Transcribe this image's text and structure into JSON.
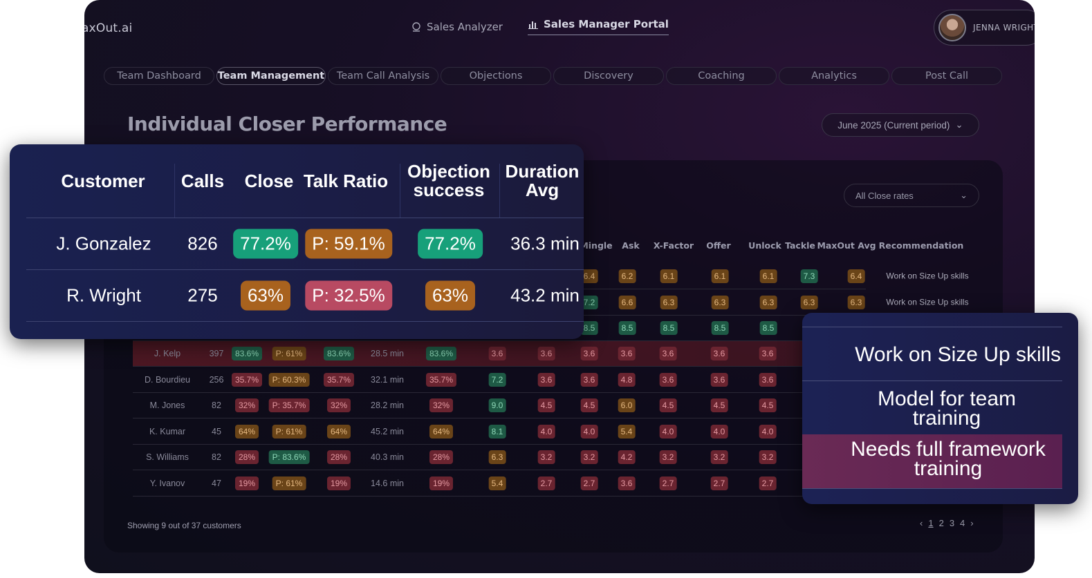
{
  "header": {
    "logo": "axOut.ai",
    "nav": [
      {
        "label": "Sales Analyzer",
        "icon": "analyzer-icon"
      },
      {
        "label": "Sales Manager Portal",
        "icon": "bar-chart-icon"
      }
    ],
    "user": {
      "name": "JENNA WRIGHT"
    }
  },
  "tabs": [
    "Team Dashboard",
    "Team Management",
    "Team Call Analysis",
    "Objections",
    "Discovery",
    "Coaching",
    "Analytics",
    "Post Call"
  ],
  "page": {
    "title": "Individual Closer Performance",
    "period": "June 2025 (Current period)",
    "rate_filter": "All Close rates"
  },
  "table": {
    "columns_visible": [
      "Mingle",
      "Ask",
      "X-Factor",
      "Offer",
      "Unlock",
      "Tackle",
      "MaxOut Avg",
      "Recommendation"
    ],
    "partial_rows": [
      {
        "scores": [
          "6.4",
          "6.2",
          "6.1",
          "6.1",
          "6.1",
          "7.3",
          "6.4"
        ],
        "colors": [
          "o",
          "o",
          "o",
          "o",
          "o",
          "g",
          "o"
        ],
        "rec": "Work on Size Up skills"
      },
      {
        "scores": [
          "7.2",
          "6.6",
          "6.3",
          "6.3",
          "6.3",
          "6.3",
          "6.3"
        ],
        "colors": [
          "g",
          "o",
          "o",
          "o",
          "o",
          "o",
          "o"
        ],
        "rec": "Work on Size Up skills"
      },
      {
        "scores": [
          "8.5",
          "8.5",
          "8.5",
          "8.5",
          "8.5",
          "",
          ""
        ],
        "colors": [
          "g",
          "g",
          "g",
          "g",
          "g",
          "",
          ""
        ],
        "rec": ""
      }
    ],
    "rows": [
      {
        "name": "J. Kelp",
        "calls": "397",
        "close": "83.6%",
        "close_c": "g",
        "talk": "P: 61%",
        "talk_c": "o",
        "obj": "83.6%",
        "obj_c": "g",
        "dur": "28.5 min",
        "c6": "83.6%",
        "c6_c": "g",
        "s": [
          "3.6",
          "3.6",
          "3.6",
          "3.6",
          "3.6",
          "3.6",
          "3.6"
        ],
        "s_c": [
          "r",
          "r",
          "r",
          "r",
          "r",
          "r",
          "r"
        ]
      },
      {
        "name": "D. Bourdieu",
        "calls": "256",
        "close": "35.7%",
        "close_c": "r",
        "talk": "P: 60.3%",
        "talk_c": "o",
        "obj": "35.7%",
        "obj_c": "r",
        "dur": "32.1 min",
        "c6": "35.7%",
        "c6_c": "r",
        "s": [
          "7.2",
          "3.6",
          "3.6",
          "4.8",
          "3.6",
          "3.6",
          "3.6"
        ],
        "s_c": [
          "g",
          "r",
          "r",
          "r",
          "r",
          "r",
          "r"
        ]
      },
      {
        "name": "M. Jones",
        "calls": "82",
        "close": "32%",
        "close_c": "r",
        "talk": "P: 35.7%",
        "talk_c": "r",
        "obj": "32%",
        "obj_c": "r",
        "dur": "28.2 min",
        "c6": "32%",
        "c6_c": "r",
        "s": [
          "9.0",
          "4.5",
          "4.5",
          "6.0",
          "4.5",
          "4.5",
          "4.5"
        ],
        "s_c": [
          "g",
          "r",
          "r",
          "o",
          "r",
          "r",
          "r"
        ]
      },
      {
        "name": "K. Kumar",
        "calls": "45",
        "close": "64%",
        "close_c": "o",
        "talk": "P: 61%",
        "talk_c": "o",
        "obj": "64%",
        "obj_c": "o",
        "dur": "45.2 min",
        "c6": "64%",
        "c6_c": "o",
        "s": [
          "8.1",
          "4.0",
          "4.0",
          "5.4",
          "4.0",
          "4.0",
          "4.0"
        ],
        "s_c": [
          "g",
          "r",
          "r",
          "o",
          "r",
          "r",
          "r"
        ]
      },
      {
        "name": "S. Williams",
        "calls": "82",
        "close": "28%",
        "close_c": "r",
        "talk": "P: 83.6%",
        "talk_c": "g",
        "obj": "28%",
        "obj_c": "r",
        "dur": "40.3 min",
        "c6": "28%",
        "c6_c": "r",
        "s": [
          "6.3",
          "3.2",
          "3.2",
          "4.2",
          "3.2",
          "3.2",
          "3.2"
        ],
        "s_c": [
          "o",
          "r",
          "r",
          "r",
          "r",
          "r",
          "r"
        ]
      },
      {
        "name": "Y. Ivanov",
        "calls": "47",
        "close": "19%",
        "close_c": "r",
        "talk": "P: 61%",
        "talk_c": "o",
        "obj": "19%",
        "obj_c": "r",
        "dur": "14.6 min",
        "c6": "19%",
        "c6_c": "r",
        "s": [
          "5.4",
          "2.7",
          "2.7",
          "3.6",
          "2.7",
          "2.7",
          "2.7"
        ],
        "s_c": [
          "o",
          "r",
          "r",
          "r",
          "r",
          "r",
          "r"
        ]
      }
    ],
    "footer": "Showing 9 out of 37 customers",
    "pages": [
      "1",
      "2",
      "3",
      "4"
    ]
  },
  "card_left": {
    "headers": [
      "Customer",
      "Calls",
      "Close",
      "Talk Ratio",
      "Objection success",
      "Duration Avg"
    ],
    "rows": [
      {
        "customer": "J. Gonzalez",
        "calls": "826",
        "close": "77.2%",
        "close_c": "g",
        "talk": "P: 59.1%",
        "talk_c": "o",
        "obj": "77.2%",
        "obj_c": "g",
        "dur": "36.3 min"
      },
      {
        "customer": "R. Wright",
        "calls": "275",
        "close": "63%",
        "close_c": "o",
        "talk": "P: 32.5%",
        "talk_c": "r",
        "obj": "63%",
        "obj_c": "o",
        "dur": "43.2 min"
      }
    ]
  },
  "card_right": {
    "items": [
      "Work on Size Up skills",
      "Model for team training",
      "Needs full framework training"
    ]
  }
}
